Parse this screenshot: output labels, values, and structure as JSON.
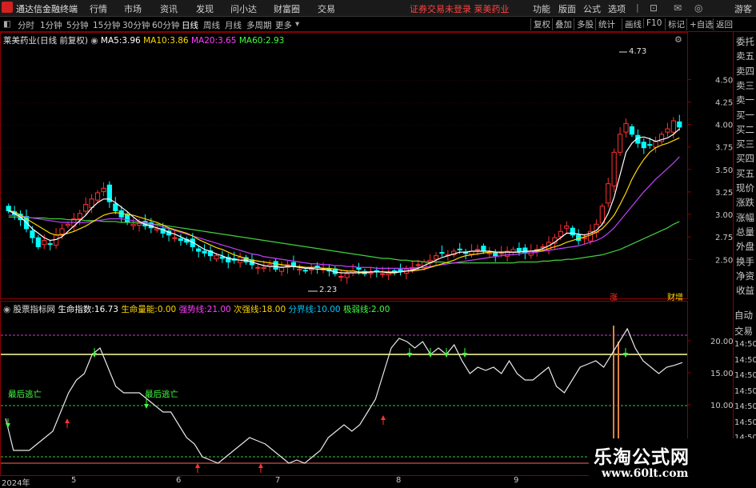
{
  "app": {
    "title": "通达信金融终端",
    "menu": [
      "行情",
      "市场",
      "资讯",
      "发现",
      "问小达",
      "财富圈",
      "交易"
    ],
    "notice": "证券交易未登录   莱美药业",
    "right_menu": [
      "功能",
      "版面",
      "公式",
      "选项"
    ],
    "user": "游客"
  },
  "toolbar": {
    "periods": [
      "分时",
      "1分钟",
      "5分钟",
      "15分钟",
      "30分钟",
      "60分钟",
      "日线",
      "周线",
      "月线",
      "多周期",
      "更多"
    ],
    "active_period": "日线",
    "right_tools": [
      "复权",
      "叠加",
      "多股",
      "统计",
      "画线",
      "F10",
      "标记",
      "+自选",
      "返回"
    ]
  },
  "price_panel": {
    "stock_name": "莱美药业(日线 前复权)",
    "ma": [
      {
        "label": "MA5:",
        "value": "3.96",
        "color": "#ffffff"
      },
      {
        "label": "MA10:",
        "value": "3.86",
        "color": "#ffd700"
      },
      {
        "label": "MA20:",
        "value": "3.65",
        "color": "#ff40ff"
      },
      {
        "label": "MA60:",
        "value": "2.93",
        "color": "#40ff40"
      }
    ],
    "high_label": "4.73",
    "low_label": "2.23",
    "y_ticks": [
      "4.50",
      "4.25",
      "4.00",
      "3.75",
      "3.50",
      "3.25",
      "3.00",
      "2.75",
      "2.50"
    ],
    "marks": [
      "涨",
      "财增"
    ]
  },
  "indicator_panel": {
    "title": "股票指标网",
    "items": [
      {
        "label": "生命指数:",
        "value": "16.73",
        "color": "#ffffff"
      },
      {
        "label": "生命量能:",
        "value": "0.00",
        "color": "#ffd700"
      },
      {
        "label": "强势线:",
        "value": "21.00",
        "color": "#ff40ff"
      },
      {
        "label": "次强线:",
        "value": "18.00",
        "color": "#ffd700"
      },
      {
        "label": "分界线:",
        "value": "10.00",
        "color": "#00c8ff"
      },
      {
        "label": "极弱线:",
        "value": "2.00",
        "color": "#40ff40"
      }
    ],
    "y_ticks": [
      "20.00",
      "15.00",
      "10.00"
    ],
    "annotations": [
      "最后逃亡",
      "最后逃亡"
    ]
  },
  "right_panel": {
    "items": [
      "委托",
      "卖五",
      "卖四",
      "卖三",
      "卖一",
      "买一",
      "买二",
      "买三",
      "买四",
      "买五",
      "现价",
      "涨跌",
      "涨幅",
      "总量",
      "外盘",
      "换手",
      "净资",
      "收益"
    ],
    "items2": [
      "自动",
      "交易",
      "14:50",
      "14:50",
      "14:50",
      "14:50",
      "14:50",
      "14:50",
      "14:50",
      "14:50"
    ]
  },
  "date_axis": [
    "2024年",
    "5",
    "6",
    "7",
    "8",
    "9"
  ],
  "watermark": {
    "line1": "乐淘公式网",
    "line2": "www.60lt.com"
  },
  "colors": {
    "up": "#ff3030",
    "down": "#00ffff",
    "ma5": "#ffffff",
    "ma10": "#ffd700",
    "ma20": "#c040ff",
    "ma60": "#40d040",
    "frame": "#8b0000"
  },
  "chart_data": {
    "type": "candlestick",
    "ylim": [
      2.2,
      4.85
    ],
    "closes": [
      3.05,
      3.0,
      2.95,
      2.85,
      2.75,
      2.65,
      2.72,
      2.68,
      2.78,
      2.85,
      2.9,
      2.96,
      3.02,
      3.12,
      3.18,
      3.25,
      3.3,
      3.15,
      3.05,
      2.98,
      2.92,
      2.9,
      2.92,
      2.88,
      2.86,
      2.85,
      2.8,
      2.78,
      2.75,
      2.72,
      2.7,
      2.65,
      2.6,
      2.58,
      2.55,
      2.55,
      2.52,
      2.48,
      2.5,
      2.53,
      2.48,
      2.45,
      2.42,
      2.42,
      2.45,
      2.4,
      2.42,
      2.45,
      2.43,
      2.4,
      2.38,
      2.4,
      2.42,
      2.4,
      2.38,
      2.35,
      2.32,
      2.35,
      2.38,
      2.4,
      2.35,
      2.36,
      2.38,
      2.35,
      2.37,
      2.36,
      2.38,
      2.4,
      2.42,
      2.45,
      2.48,
      2.5,
      2.55,
      2.58,
      2.56,
      2.6,
      2.62,
      2.58,
      2.6,
      2.62,
      2.6,
      2.58,
      2.55,
      2.58,
      2.6,
      2.62,
      2.6,
      2.58,
      2.6,
      2.62,
      2.65,
      2.7,
      2.75,
      2.82,
      2.88,
      2.78,
      2.72,
      2.75,
      2.82,
      2.9,
      3.1,
      3.35,
      3.7,
      3.9,
      4.02,
      3.9,
      3.8,
      3.75,
      3.78,
      3.82,
      3.9,
      3.96,
      4.05,
      3.98
    ],
    "ma5": [
      3.05,
      3.02,
      2.98,
      2.92,
      2.85,
      2.8,
      2.75,
      2.72,
      2.73,
      2.76,
      2.82,
      2.88,
      2.94,
      3.0,
      3.08,
      3.14,
      3.18,
      3.18,
      3.14,
      3.09,
      3.04,
      2.98,
      2.93,
      2.9,
      2.88,
      2.86,
      2.84,
      2.81,
      2.79,
      2.76,
      2.73,
      2.7,
      2.66,
      2.62,
      2.6,
      2.57,
      2.55,
      2.52,
      2.51,
      2.5,
      2.5,
      2.48,
      2.46,
      2.44,
      2.43,
      2.43,
      2.42,
      2.43,
      2.43,
      2.42,
      2.41,
      2.41,
      2.4,
      2.4,
      2.39,
      2.37,
      2.36,
      2.36,
      2.36,
      2.36,
      2.36,
      2.37,
      2.37,
      2.37,
      2.36,
      2.36,
      2.37,
      2.38,
      2.39,
      2.41,
      2.44,
      2.47,
      2.5,
      2.53,
      2.55,
      2.57,
      2.59,
      2.59,
      2.6,
      2.6,
      2.6,
      2.6,
      2.59,
      2.59,
      2.59,
      2.59,
      2.59,
      2.6,
      2.6,
      2.61,
      2.63,
      2.66,
      2.7,
      2.75,
      2.8,
      2.8,
      2.79,
      2.78,
      2.8,
      2.83,
      2.9,
      3.02,
      3.2,
      3.45,
      3.7,
      3.8,
      3.86,
      3.87,
      3.85,
      3.82,
      3.84,
      3.86,
      3.9,
      3.96
    ],
    "ma10": [
      3.05,
      3.04,
      3.0,
      2.96,
      2.92,
      2.88,
      2.84,
      2.8,
      2.78,
      2.78,
      2.8,
      2.82,
      2.85,
      2.88,
      2.92,
      2.96,
      3.0,
      3.02,
      3.03,
      3.02,
      3.01,
      3.0,
      2.98,
      2.96,
      2.94,
      2.92,
      2.89,
      2.86,
      2.84,
      2.82,
      2.8,
      2.77,
      2.73,
      2.7,
      2.67,
      2.64,
      2.62,
      2.59,
      2.56,
      2.54,
      2.52,
      2.5,
      2.49,
      2.48,
      2.47,
      2.46,
      2.45,
      2.44,
      2.43,
      2.43,
      2.42,
      2.42,
      2.42,
      2.41,
      2.41,
      2.4,
      2.39,
      2.38,
      2.38,
      2.37,
      2.37,
      2.37,
      2.37,
      2.37,
      2.37,
      2.37,
      2.37,
      2.38,
      2.38,
      2.39,
      2.4,
      2.42,
      2.44,
      2.46,
      2.48,
      2.5,
      2.53,
      2.55,
      2.56,
      2.57,
      2.58,
      2.59,
      2.59,
      2.59,
      2.59,
      2.59,
      2.59,
      2.6,
      2.6,
      2.6,
      2.61,
      2.63,
      2.65,
      2.67,
      2.7,
      2.72,
      2.74,
      2.76,
      2.78,
      2.81,
      2.85,
      2.92,
      3.0,
      3.12,
      3.25,
      3.4,
      3.52,
      3.62,
      3.7,
      3.75,
      3.78,
      3.8,
      3.83,
      3.86
    ],
    "ma20": [
      3.0,
      3.0,
      2.99,
      2.98,
      2.97,
      2.96,
      2.95,
      2.94,
      2.93,
      2.92,
      2.92,
      2.92,
      2.92,
      2.92,
      2.93,
      2.94,
      2.95,
      2.96,
      2.96,
      2.96,
      2.95,
      2.94,
      2.93,
      2.92,
      2.9,
      2.89,
      2.87,
      2.85,
      2.83,
      2.81,
      2.79,
      2.77,
      2.75,
      2.73,
      2.71,
      2.69,
      2.67,
      2.65,
      2.63,
      2.61,
      2.59,
      2.57,
      2.56,
      2.54,
      2.53,
      2.52,
      2.51,
      2.5,
      2.49,
      2.48,
      2.47,
      2.46,
      2.46,
      2.45,
      2.45,
      2.44,
      2.44,
      2.43,
      2.43,
      2.42,
      2.42,
      2.42,
      2.41,
      2.41,
      2.41,
      2.41,
      2.41,
      2.41,
      2.41,
      2.42,
      2.42,
      2.43,
      2.44,
      2.45,
      2.46,
      2.47,
      2.48,
      2.49,
      2.5,
      2.51,
      2.52,
      2.53,
      2.54,
      2.55,
      2.56,
      2.56,
      2.57,
      2.58,
      2.58,
      2.59,
      2.6,
      2.61,
      2.62,
      2.63,
      2.64,
      2.65,
      2.66,
      2.68,
      2.7,
      2.72,
      2.75,
      2.8,
      2.86,
      2.94,
      3.02,
      3.1,
      3.18,
      3.26,
      3.33,
      3.4,
      3.46,
      3.52,
      3.58,
      3.65
    ],
    "ma60": [
      2.98,
      2.98,
      2.98,
      2.98,
      2.97,
      2.97,
      2.97,
      2.96,
      2.96,
      2.96,
      2.95,
      2.95,
      2.95,
      2.94,
      2.94,
      2.94,
      2.93,
      2.93,
      2.93,
      2.92,
      2.92,
      2.92,
      2.91,
      2.91,
      2.9,
      2.9,
      2.89,
      2.88,
      2.87,
      2.86,
      2.85,
      2.84,
      2.83,
      2.82,
      2.81,
      2.8,
      2.79,
      2.78,
      2.77,
      2.76,
      2.75,
      2.74,
      2.73,
      2.72,
      2.71,
      2.7,
      2.69,
      2.68,
      2.67,
      2.66,
      2.65,
      2.64,
      2.63,
      2.62,
      2.61,
      2.6,
      2.59,
      2.58,
      2.57,
      2.56,
      2.55,
      2.54,
      2.53,
      2.52,
      2.52,
      2.51,
      2.5,
      2.5,
      2.49,
      2.49,
      2.48,
      2.48,
      2.48,
      2.48,
      2.47,
      2.47,
      2.47,
      2.47,
      2.47,
      2.47,
      2.47,
      2.47,
      2.47,
      2.47,
      2.47,
      2.47,
      2.48,
      2.48,
      2.48,
      2.48,
      2.49,
      2.49,
      2.5,
      2.5,
      2.51,
      2.51,
      2.52,
      2.53,
      2.54,
      2.55,
      2.56,
      2.58,
      2.6,
      2.62,
      2.65,
      2.68,
      2.71,
      2.74,
      2.77,
      2.8,
      2.83,
      2.86,
      2.9,
      2.93
    ],
    "indicator": {
      "life_index": [
        8,
        3,
        3,
        3,
        4,
        5,
        6,
        9,
        12,
        14,
        15,
        18,
        19,
        16,
        13,
        12,
        12,
        12,
        11,
        10,
        9,
        9,
        7,
        5,
        4,
        2,
        1.5,
        1,
        2,
        3,
        4,
        5,
        4.5,
        4,
        3,
        2,
        1,
        1.5,
        1,
        2,
        3,
        5,
        6,
        7,
        6,
        7,
        9,
        11,
        15,
        19,
        20.5,
        20,
        19,
        20,
        18,
        19,
        18,
        19.5,
        17,
        15,
        16,
        15.5,
        16,
        15,
        17,
        15,
        14,
        14,
        15,
        16,
        13,
        12,
        14,
        16,
        16.5,
        17,
        16,
        18,
        20,
        22,
        19,
        17,
        16,
        15,
        16,
        16.3,
        16.73
      ],
      "ylim": [
        0,
        24
      ],
      "lines": [
        21,
        18,
        10,
        2
      ]
    }
  }
}
